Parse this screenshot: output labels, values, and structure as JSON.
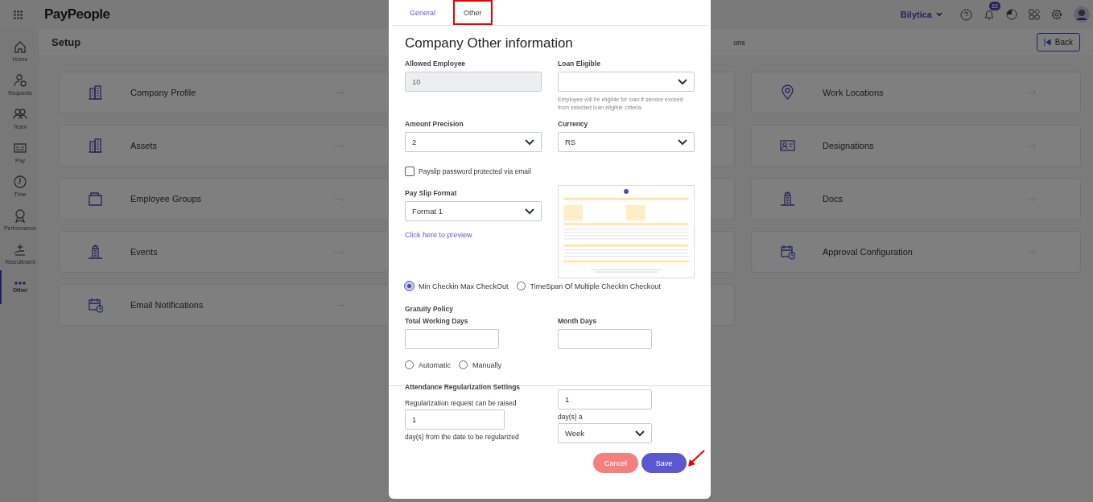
{
  "topbar": {
    "logo": "PayPeople",
    "company": "Bilytica",
    "notification_count": "22"
  },
  "sidebar": {
    "items": [
      {
        "label": "Home",
        "selected": false
      },
      {
        "label": "Requests",
        "selected": false
      },
      {
        "label": "Team",
        "selected": false
      },
      {
        "label": "Pay",
        "selected": false
      },
      {
        "label": "Time",
        "selected": false
      },
      {
        "label": "Performance",
        "selected": false
      },
      {
        "label": "Recruitment",
        "selected": false
      },
      {
        "label": "Other",
        "selected": true
      }
    ]
  },
  "page": {
    "title": "Setup",
    "header_fragment": "ons",
    "back_button": "Back"
  },
  "left_cards": [
    {
      "label": "Company Profile"
    },
    {
      "label": "Assets"
    },
    {
      "label": "Employee Groups"
    },
    {
      "label": "Events"
    },
    {
      "label": "Email Notifications"
    }
  ],
  "right_cards": [
    {
      "label": "Work Locations"
    },
    {
      "label": "Designations"
    },
    {
      "label": "Docs"
    },
    {
      "label": "Approval Configuration"
    }
  ],
  "dialog": {
    "tabs": [
      {
        "label": "General",
        "selected": false
      },
      {
        "label": "Other",
        "selected": true
      }
    ],
    "title": "Company Other information",
    "allowed_employee": {
      "label": "Allowed Employee",
      "value": "10",
      "disabled": true
    },
    "loan_eligible": {
      "label": "Loan Eligible",
      "hint": "Employee will be eligible for loan if service exceed from selected loan eligible criteria."
    },
    "amount_precision": {
      "label": "Amount Precision",
      "value": "2"
    },
    "currency": {
      "label": "Currency",
      "value": "RS"
    },
    "payslip_password": {
      "label": "Payslip password protected via email",
      "checked": false
    },
    "pay_slip_format": {
      "label": "Pay Slip Format",
      "value": "Format 1",
      "preview_link": "Click here to preview"
    },
    "checkin_mode": [
      {
        "label": "Min Checkin Max CheckOut",
        "selected": true
      },
      {
        "label": "TimeSpan Of Multiple CheckIn Checkout",
        "selected": false
      }
    ],
    "gratuity": {
      "heading": "Gratuity Policy",
      "total_working_days": {
        "label": "Total Working Days"
      },
      "month_days": {
        "label": "Month Days"
      },
      "options": [
        {
          "label": "Automatic",
          "selected": false
        },
        {
          "label": "Manually",
          "selected": false
        }
      ]
    },
    "attendance": {
      "heading": "Attendance Regularization Settings",
      "request_label": "Regularization request can be raised",
      "request_value": "1",
      "request_suffix": "day(s) from the date to be regularized",
      "count_value": "1",
      "count_label": "day(s) a",
      "period": "Week"
    },
    "buttons": [
      {
        "label": "Cancel",
        "kind": "cancel"
      },
      {
        "label": "Save",
        "kind": "save"
      }
    ]
  }
}
